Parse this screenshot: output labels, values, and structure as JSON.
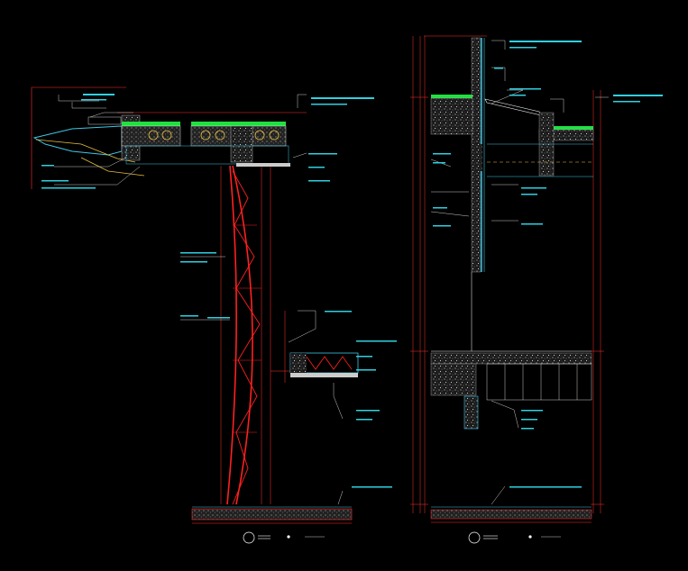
{
  "colors": {
    "background": "#000000",
    "truss": "#ff2020",
    "dimension": "#ff3030",
    "leader": "#ffffff",
    "annotation": "#2fd0e0",
    "steel": "#3cc8e6",
    "green_finish": "#20e040",
    "yellow_pipe": "#e8c040",
    "concrete": "#9a9a9a"
  },
  "icons": {
    "section_marker_left": "circle-section-marker-icon",
    "section_marker_right": "circle-section-marker-icon"
  }
}
